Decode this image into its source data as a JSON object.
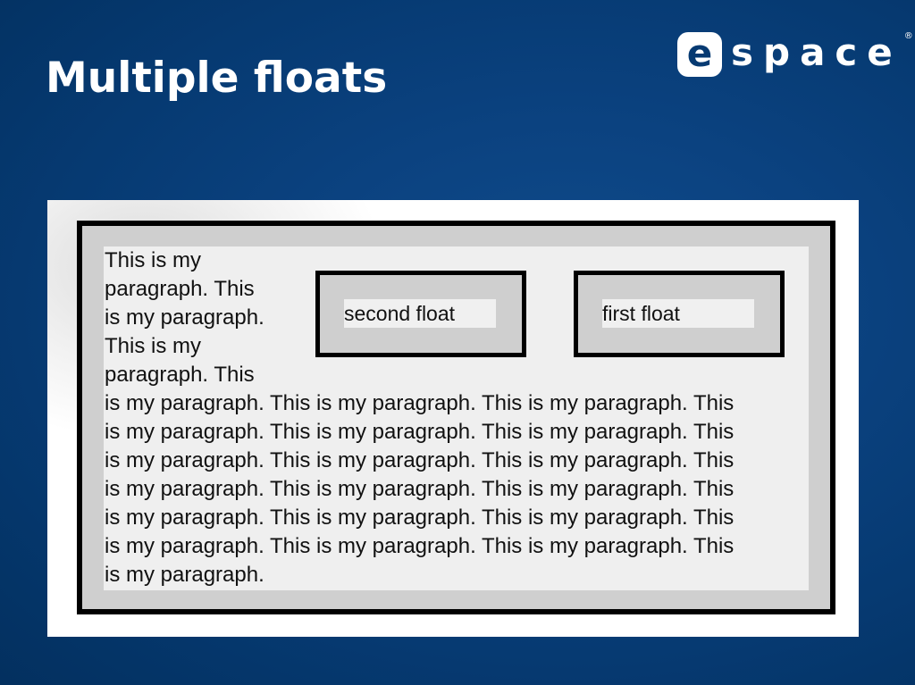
{
  "slide": {
    "title": "Multiple floats"
  },
  "logo": {
    "letter": "e",
    "text": "space",
    "mark": "®"
  },
  "example": {
    "second_float": "second float",
    "first_float": "first float",
    "paragraph_lines": [
      "This is my",
      "paragraph. This",
      "is my paragraph.",
      "This is my",
      "paragraph. This",
      "is my paragraph. This is my paragraph. This is my paragraph. This",
      "is my paragraph. This is my paragraph. This is my paragraph. This",
      "is my paragraph. This is my paragraph. This is my paragraph. This",
      "is my paragraph. This is my paragraph. This is my paragraph. This",
      "is my paragraph. This is my paragraph. This is my paragraph. This",
      "is my paragraph. This is my paragraph. This is my paragraph. This",
      "is my paragraph."
    ]
  },
  "colors": {
    "background": "#063a72",
    "outer_box": "#cfcfcf",
    "content_area": "#efefef",
    "border": "#000000"
  }
}
